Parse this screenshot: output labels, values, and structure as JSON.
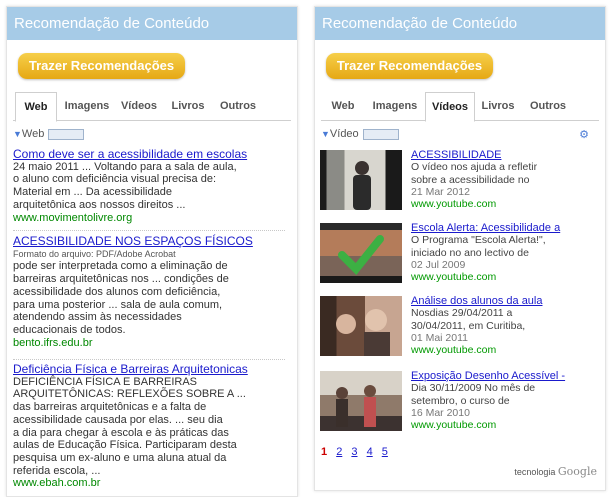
{
  "left": {
    "title": "Recomendação de Conteúdo",
    "button": "Trazer Recomendações",
    "tabs": [
      "Web",
      "Imagens",
      "Vídeos",
      "Livros",
      "Outros"
    ],
    "selected_tab": "Web",
    "section": "Web",
    "results": [
      {
        "title": "Como deve ser a acessibilidade em escolas",
        "lines": [
          "24 maio 2011 ... Voltando para a sala de aula,",
          "o aluno com deficiência visual precisa de:",
          "Material em ... Da acessibilidade",
          "arquitetônica aos nossos direitos ..."
        ],
        "url": "www.movimentolivre.org"
      },
      {
        "title": "ACESSIBILIDADE NOS ESPAÇOS FÍSICOS",
        "format": "Formato do arquivo: PDF/Adobe Acrobat",
        "lines": [
          "pode ser interpretada como a eliminação de",
          "barreiras arquitetônicas nos ... condições de",
          "acessibilidade dos alunos com deficiência,",
          "para uma posterior ... sala de aula comum,",
          "atendendo assim às necessidades",
          "educacionais de todos."
        ],
        "url": "bento.ifrs.edu.br"
      },
      {
        "title": "Deficiência Física e Barreiras Arquitetonicas",
        "lines": [
          "DEFICIÊNCIA FÍSICA E BARREIRAS",
          "ARQUITETÔNICAS: REFLEXÕES SOBRE A ...",
          "das barreiras arquitetônicas e a falta de",
          "acessibilidade causada por elas. ... seu dia",
          "a dia para chegar à escola e às práticas das",
          "aulas de Educação Física. Participaram desta",
          "pesquisa um ex-aluno e uma aluna atual da",
          "referida escola, ..."
        ],
        "url": "www.ebah.com.br"
      }
    ]
  },
  "right": {
    "title": "Recomendação de Conteúdo",
    "button": "Trazer Recomendações",
    "tabs": [
      "Web",
      "Imagens",
      "Vídeos",
      "Livros",
      "Outros"
    ],
    "selected_tab": "Vídeos",
    "section": "Vídeo",
    "videos": [
      {
        "title": "ACESSIBILIDADE",
        "desc": [
          "O vídeo nos ajuda a refletir",
          "sobre a acessibilidade no"
        ],
        "date": "21 Mar 2012",
        "url": "www.youtube.com"
      },
      {
        "title": "Escola Alerta: Acessibilidade a",
        "desc": [
          "O Programa \"Escola Alerta!\",",
          "iniciado no ano lectivo de"
        ],
        "date": "02 Jul 2009",
        "url": "www.youtube.com"
      },
      {
        "title": "Análise dos alunos da aula",
        "desc": [
          "Nosdias 29/04/2011 a",
          "30/04/2011, em Curitiba,"
        ],
        "date": "01 Mai 2011",
        "url": "www.youtube.com"
      },
      {
        "title": "Exposição Desenho Acessível -",
        "desc": [
          "Dia 30/11/2009 No mês de",
          "setembro, o curso de"
        ],
        "date": "16 Mar 2010",
        "url": "www.youtube.com"
      }
    ],
    "pages": [
      "1",
      "2",
      "3",
      "4",
      "5"
    ],
    "current_page": "1",
    "branding_prefix": "tecnologia",
    "branding_name": "Google"
  }
}
